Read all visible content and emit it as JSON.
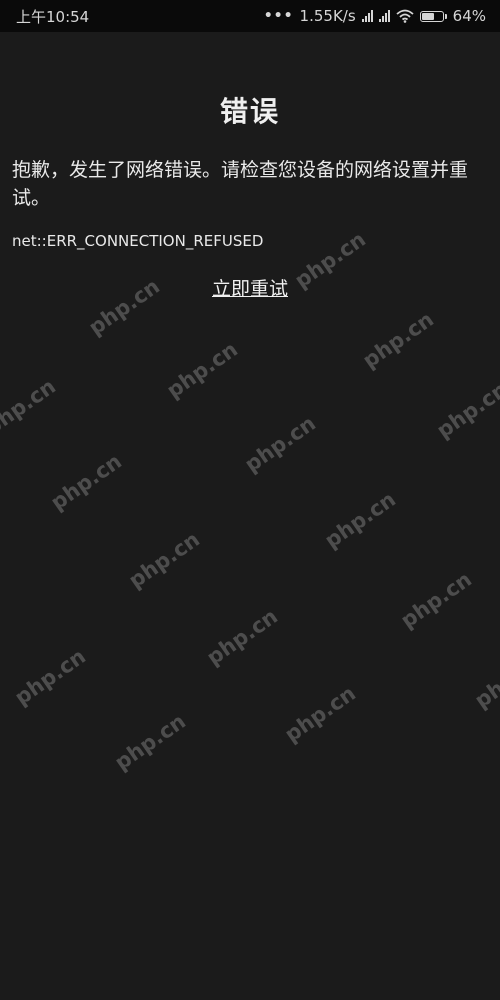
{
  "status_bar": {
    "time": "上午10:54",
    "dots": "•••",
    "network_speed": "1.55K/s",
    "battery_level": 0.64,
    "battery_text": "64%"
  },
  "error_page": {
    "title": "错误",
    "message": "抱歉，发生了网络错误。请检查您设备的网络设置并重试。",
    "error_code": "net::ERR_CONNECTION_REFUSED",
    "retry_label": "立即重试"
  },
  "watermark": {
    "text": "php.cn"
  },
  "colors": {
    "background": "#1b1b1b",
    "status_bar": "#0a0a0a",
    "text": "#e9e9e9"
  }
}
